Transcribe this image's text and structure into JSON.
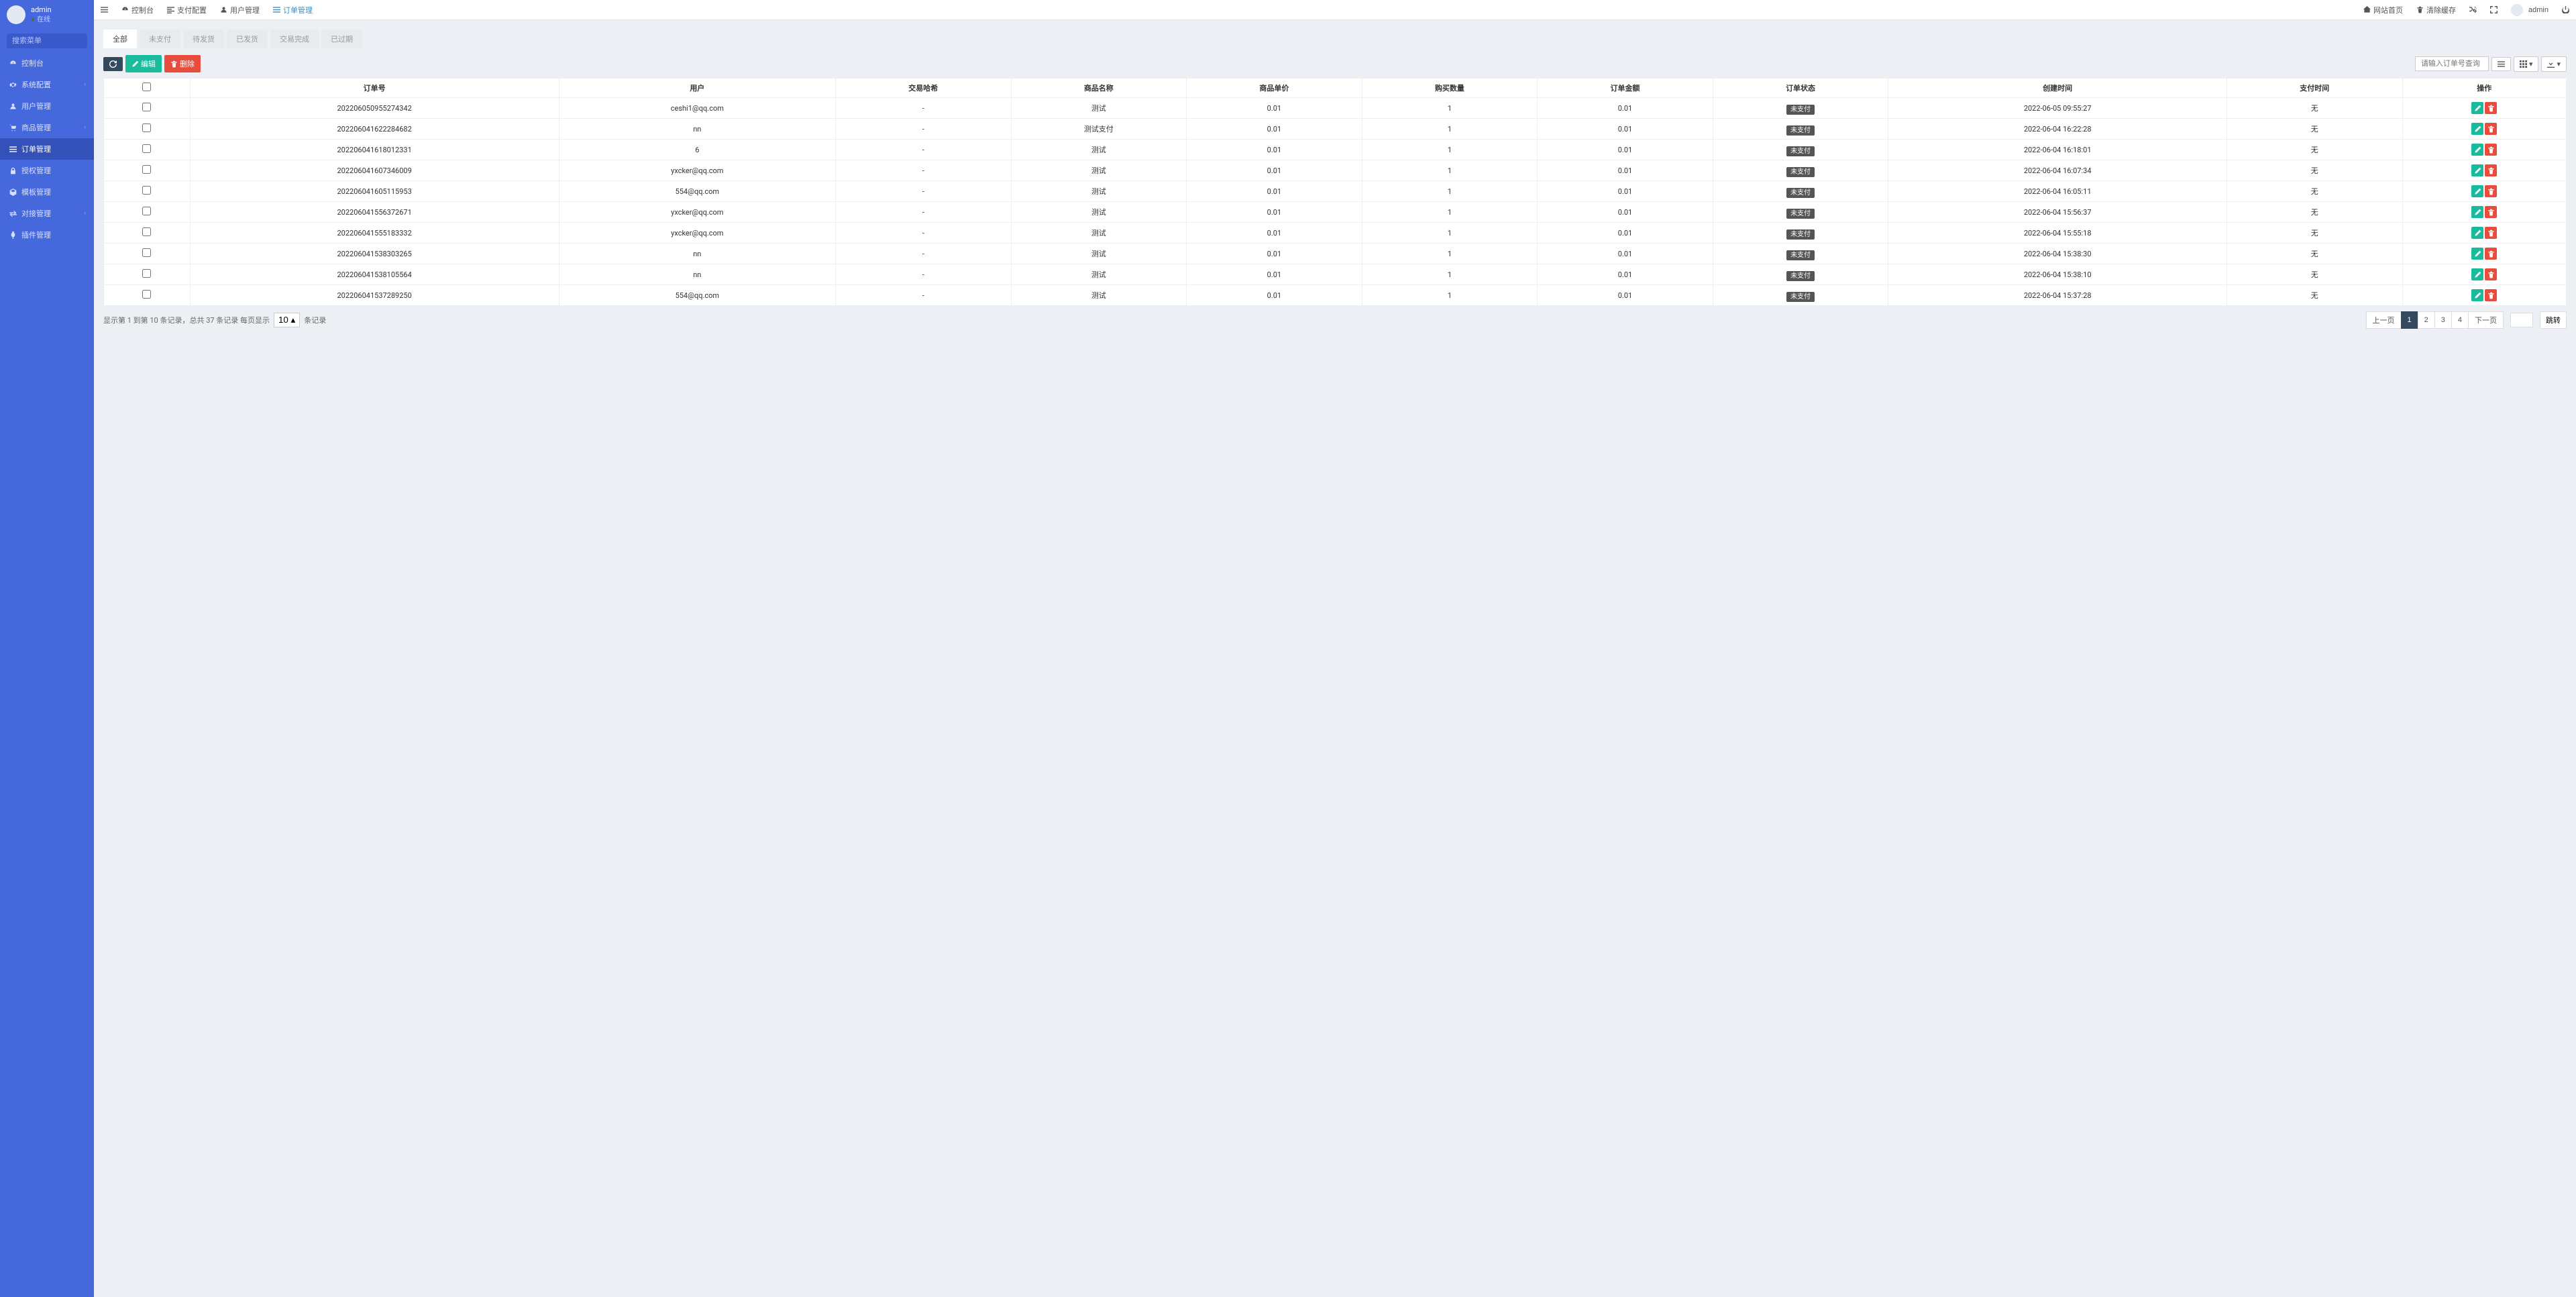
{
  "sidebar": {
    "username": "admin",
    "status": "在线",
    "search_placeholder": "搜索菜单",
    "items": [
      {
        "icon": "tachometer",
        "label": "控制台",
        "chev": false
      },
      {
        "icon": "cog",
        "label": "系统配置",
        "chev": true
      },
      {
        "icon": "user",
        "label": "用户管理"
      },
      {
        "icon": "cart",
        "label": "商品管理",
        "chev": true
      },
      {
        "icon": "list",
        "label": "订单管理",
        "active": true
      },
      {
        "icon": "lock",
        "label": "授权管理"
      },
      {
        "icon": "cube",
        "label": "模板管理"
      },
      {
        "icon": "exchange",
        "label": "对接管理",
        "chev": true
      },
      {
        "icon": "plug",
        "label": "插件管理"
      }
    ]
  },
  "topbar": {
    "left": [
      {
        "icon": "bars",
        "label": ""
      },
      {
        "icon": "tachometer",
        "label": "控制台"
      },
      {
        "icon": "align",
        "label": "支付配置"
      },
      {
        "icon": "user",
        "label": "用户管理"
      },
      {
        "icon": "list",
        "label": "订单管理",
        "active": true
      }
    ],
    "right": [
      {
        "icon": "home",
        "label": "网站首页"
      },
      {
        "icon": "trash",
        "label": "清除缓存"
      },
      {
        "icon": "shuffle",
        "label": ""
      },
      {
        "icon": "expand",
        "label": ""
      }
    ],
    "username": "admin"
  },
  "tabs": [
    {
      "label": "全部",
      "active": true
    },
    {
      "label": "未支付"
    },
    {
      "label": "待发货"
    },
    {
      "label": "已发货"
    },
    {
      "label": "交易完成"
    },
    {
      "label": "已过期"
    }
  ],
  "toolbar": {
    "refresh": "",
    "edit": "编辑",
    "delete": "删除",
    "search_placeholder": "请输入订单号查询"
  },
  "table": {
    "headers": [
      "订单号",
      "用户",
      "交易哈希",
      "商品名称",
      "商品单价",
      "购买数量",
      "订单金额",
      "订单状态",
      "创建时间",
      "支付时间",
      "操作"
    ],
    "rows": [
      {
        "order": "202206050955274342",
        "user": "ceshi1@qq.com",
        "hash": "-",
        "product": "测试",
        "price": "0.01",
        "qty": "1",
        "amount": "0.01",
        "status": "未支付",
        "created": "2022-06-05 09:55:27",
        "paid": "无"
      },
      {
        "order": "202206041622284682",
        "user": "nn",
        "hash": "-",
        "product": "测试支付",
        "price": "0.01",
        "qty": "1",
        "amount": "0.01",
        "status": "未支付",
        "created": "2022-06-04 16:22:28",
        "paid": "无"
      },
      {
        "order": "202206041618012331",
        "user": "6",
        "hash": "-",
        "product": "测试",
        "price": "0.01",
        "qty": "1",
        "amount": "0.01",
        "status": "未支付",
        "created": "2022-06-04 16:18:01",
        "paid": "无"
      },
      {
        "order": "202206041607346009",
        "user": "yxcker@qq.com",
        "hash": "-",
        "product": "测试",
        "price": "0.01",
        "qty": "1",
        "amount": "0.01",
        "status": "未支付",
        "created": "2022-06-04 16:07:34",
        "paid": "无"
      },
      {
        "order": "202206041605115953",
        "user": "554@qq.com",
        "hash": "-",
        "product": "测试",
        "price": "0.01",
        "qty": "1",
        "amount": "0.01",
        "status": "未支付",
        "created": "2022-06-04 16:05:11",
        "paid": "无"
      },
      {
        "order": "202206041556372671",
        "user": "yxcker@qq.com",
        "hash": "-",
        "product": "测试",
        "price": "0.01",
        "qty": "1",
        "amount": "0.01",
        "status": "未支付",
        "created": "2022-06-04 15:56:37",
        "paid": "无"
      },
      {
        "order": "202206041555183332",
        "user": "yxcker@qq.com",
        "hash": "-",
        "product": "测试",
        "price": "0.01",
        "qty": "1",
        "amount": "0.01",
        "status": "未支付",
        "created": "2022-06-04 15:55:18",
        "paid": "无"
      },
      {
        "order": "202206041538303265",
        "user": "nn",
        "hash": "-",
        "product": "测试",
        "price": "0.01",
        "qty": "1",
        "amount": "0.01",
        "status": "未支付",
        "created": "2022-06-04 15:38:30",
        "paid": "无"
      },
      {
        "order": "202206041538105564",
        "user": "nn",
        "hash": "-",
        "product": "测试",
        "price": "0.01",
        "qty": "1",
        "amount": "0.01",
        "status": "未支付",
        "created": "2022-06-04 15:38:10",
        "paid": "无"
      },
      {
        "order": "202206041537289250",
        "user": "554@qq.com",
        "hash": "-",
        "product": "测试",
        "price": "0.01",
        "qty": "1",
        "amount": "0.01",
        "status": "未支付",
        "created": "2022-06-04 15:37:28",
        "paid": "无"
      }
    ]
  },
  "footer": {
    "info_prefix": "显示第 1 到第 10 条记录，总共 37 条记录  每页显示",
    "page_size": "10",
    "info_suffix": "条记录",
    "prev": "上一页",
    "next": "下一页",
    "pages": [
      "1",
      "2",
      "3",
      "4"
    ],
    "go": "跳转"
  }
}
